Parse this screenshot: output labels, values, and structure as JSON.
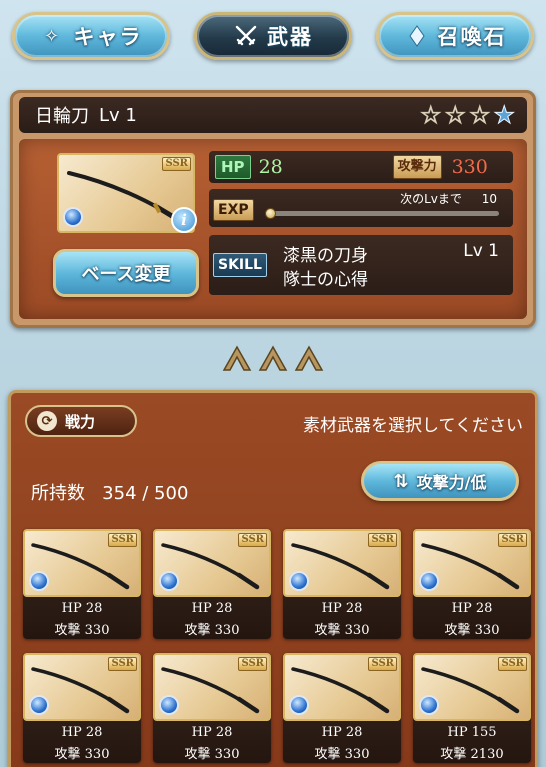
{
  "tabs": {
    "chara": "キャラ",
    "weapon": "武器",
    "summon": "召喚石"
  },
  "weapon": {
    "name": "日輪刀",
    "level": "Lv 1",
    "rarity": "SSR",
    "stars_filled": 1,
    "stars_total": 4,
    "hp_label": "HP",
    "hp": "28",
    "atk_label": "攻撃力",
    "atk": "330",
    "exp_label": "EXP",
    "exp_next_label": "次のLvまで",
    "exp_next_value": "10",
    "exp_progress": 0,
    "skill_label": "SKILL",
    "skill_1": "漆黒の刀身",
    "skill_1_level": "Lv 1",
    "skill_2": "隊士の心得",
    "base_change_label": "ベース変更"
  },
  "materials": {
    "sort_power_label": "戦力",
    "instruction": "素材武器を選択してください",
    "owned_label": "所持数",
    "owned_count": "354 / 500",
    "sort_atk_label": "攻撃力/低",
    "items": [
      {
        "hp": "HP 28",
        "atk": "攻撃 330"
      },
      {
        "hp": "HP 28",
        "atk": "攻撃 330"
      },
      {
        "hp": "HP 28",
        "atk": "攻撃 330"
      },
      {
        "hp": "HP 28",
        "atk": "攻撃 330"
      },
      {
        "hp": "HP 28",
        "atk": "攻撃 330"
      },
      {
        "hp": "HP 28",
        "atk": "攻撃 330"
      },
      {
        "hp": "HP 28",
        "atk": "攻撃 330"
      },
      {
        "hp": "HP 155",
        "atk": "攻撃 2130"
      }
    ]
  },
  "colors": {
    "button_blue": "#5fb8dc",
    "panel_brown": "#9a4a24",
    "hp_green": "#aef5a6",
    "atk_red": "#f36b4a"
  }
}
